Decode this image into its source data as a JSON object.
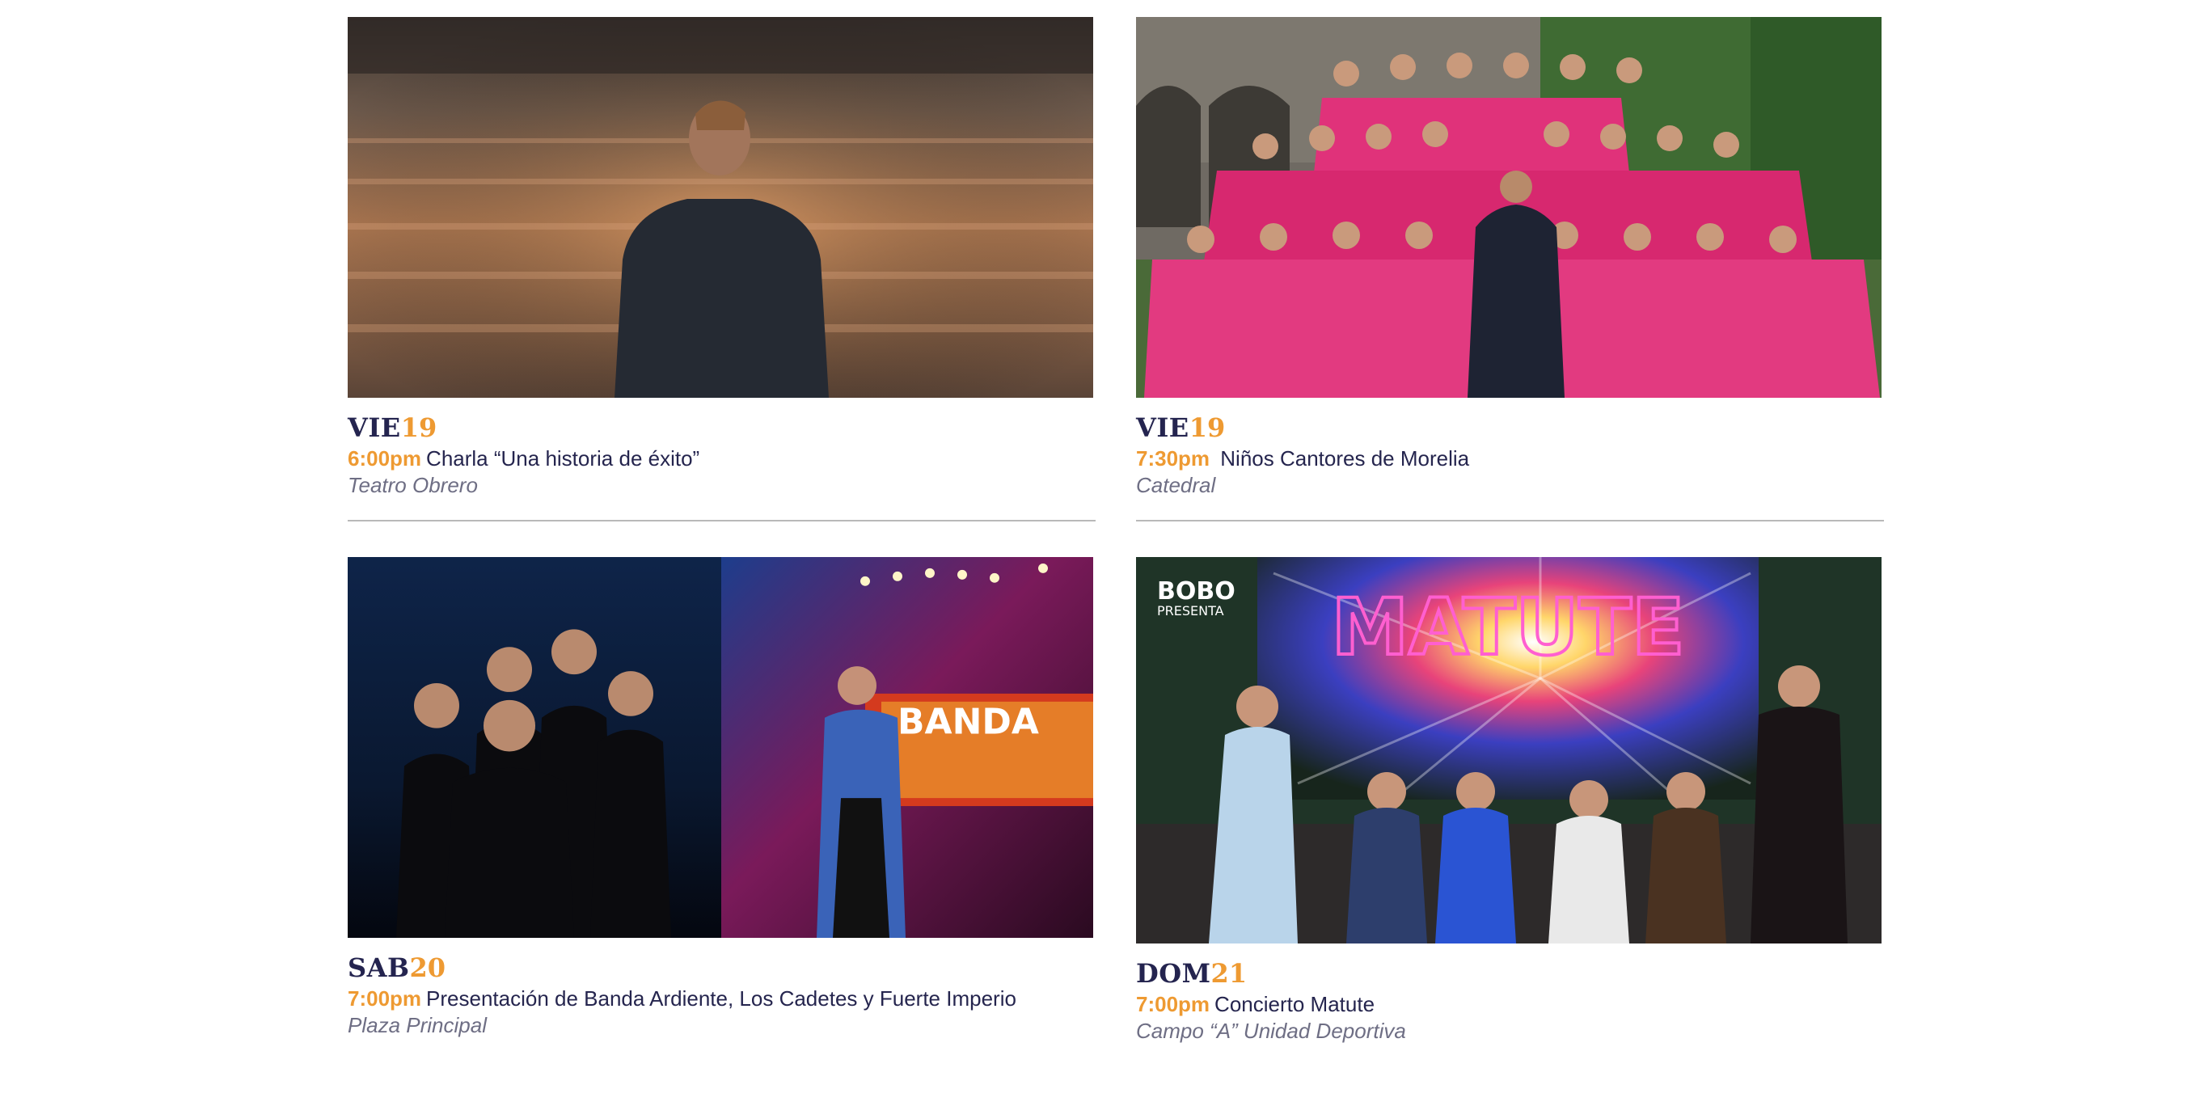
{
  "events": [
    {
      "day": "VIE",
      "date": "19",
      "time": "6:00pm",
      "title": "Charla “Una historia de  éxito”",
      "venue": "Teatro Obrero"
    },
    {
      "day": "VIE",
      "date": "19",
      "time": "7:30pm",
      "title": " Niños Cantores de Morelia",
      "venue": "Catedral"
    },
    {
      "day": "SAB",
      "date": "20",
      "time": "7:00pm",
      "title": "Presentación de Banda Ardiente, Los Cadetes y Fuerte Imperio",
      "venue": "Plaza Principal"
    },
    {
      "day": "DOM",
      "date": "21",
      "time": "7:00pm",
      "title": "Concierto Matute",
      "venue": "Campo “A” Unidad Deportiva"
    }
  ],
  "poster": {
    "brand": "BOBO",
    "presenter": "PRESENTA",
    "band_logo": "MATUTE",
    "banner_text": "BANDA"
  },
  "colors": {
    "navy": "#24244f",
    "accent_orange": "#ee9a32",
    "venue_gray": "#6e6e84",
    "divider": "#b9b9b9"
  }
}
